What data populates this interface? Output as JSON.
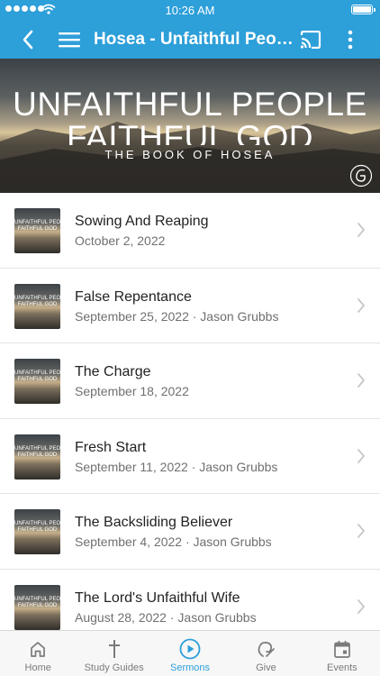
{
  "status_bar": {
    "time": "10:26 AM"
  },
  "app_bar": {
    "title": "Hosea - Unfaithful People Faithful God"
  },
  "banner": {
    "line1": "UNFAITHFUL PEOPLE",
    "line2": "FAITHFUL GOD",
    "line3": "THE BOOK OF HOSEA"
  },
  "thumbnail": {
    "line1": "UNFAITHFUL PEOPLE",
    "line2": "FAITHFUL GOD"
  },
  "sermons": [
    {
      "title": "Sowing And Reaping",
      "meta": "October 2, 2022"
    },
    {
      "title": "False Repentance",
      "meta": "September 25, 2022 · Jason Grubbs"
    },
    {
      "title": "The Charge",
      "meta": "September 18, 2022"
    },
    {
      "title": "Fresh Start",
      "meta": "September 11, 2022 · Jason Grubbs"
    },
    {
      "title": "The Backsliding Believer",
      "meta": "September 4, 2022 · Jason Grubbs"
    },
    {
      "title": "The Lord's Unfaithful Wife",
      "meta": "August 28, 2022 · Jason Grubbs"
    }
  ],
  "tabs": [
    {
      "label": "Home",
      "icon": "home-icon"
    },
    {
      "label": "Study Guides",
      "icon": "cross-icon"
    },
    {
      "label": "Sermons",
      "icon": "play-icon",
      "active": true
    },
    {
      "label": "Give",
      "icon": "give-icon"
    },
    {
      "label": "Events",
      "icon": "calendar-icon"
    }
  ],
  "colors": {
    "accent": "#2d9fd9",
    "inactive": "#7a7a7a"
  }
}
